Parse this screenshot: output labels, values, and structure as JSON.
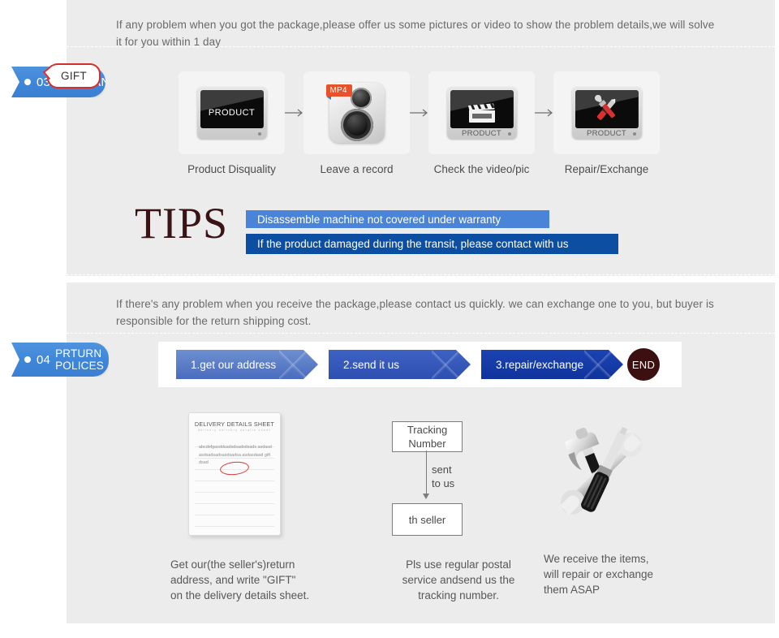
{
  "sections": {
    "warranty": {
      "tab": {
        "dot": true,
        "number": "03",
        "label": "WARRANTY"
      },
      "intro": "If any problem when you got the package,please offer us some pictures or video to show the problem details,we will solve\n it for you within 1 day",
      "steps": [
        {
          "caption": "Product Disquality",
          "icon": "monitor-icon",
          "screen_label": "PRODUCT"
        },
        {
          "caption": "Leave a record",
          "icon": "camera-icon",
          "badge": "MP4"
        },
        {
          "caption": "Check the video/pic",
          "icon": "video-clapper-icon",
          "screen_label": "PRODUCT"
        },
        {
          "caption": "Repair/Exchange",
          "icon": "repair-tools-icon",
          "screen_label": "PRODUCT"
        }
      ],
      "step_arrow": "arrow-right-icon",
      "tips": {
        "word": "TIPS",
        "bars": [
          {
            "text": "Disassemble machine not covered under warranty",
            "color": "#4a84d8"
          },
          {
            "text": "If the product damaged during the transit, please contact with us",
            "color": "#0b4ea2"
          }
        ]
      }
    },
    "return": {
      "tab": {
        "dot": true,
        "number": "04",
        "label": "PRTURN\nPOLICES"
      },
      "intro": "If  there's any problem when you receive the package,please contact us quickly. we can exchange one to you, but buyer is\nresponsible for the return shipping cost.",
      "flow": {
        "steps": [
          {
            "text": "1.get our address",
            "color": "#4a6cbe"
          },
          {
            "text": "2.send it us",
            "color": "#2d4fb0"
          },
          {
            "text": "3.repair/exchange",
            "color": "#10339c"
          }
        ],
        "end": {
          "text": "END",
          "color": "#3c0f10"
        }
      },
      "columns": [
        {
          "graphic": "delivery-details-sheet",
          "sheet": {
            "title": "DELIVERY DETAILS SHEET",
            "subtitle": "delivery        delivery details sheet",
            "body": "abcdefgasddsadsdsadsdsads asdasdasdsadsadsasdsadsa asdasdasd gift dsad",
            "callout": "GIFT"
          },
          "caption": "Get our(the seller's)return\naddress, and write \"GIFT\"\non the delivery details sheet."
        },
        {
          "graphic": "tracking-flow",
          "box_top": "Tracking\nNumber",
          "arrow_label": "sent\nto us",
          "box_bottom": "th seller",
          "caption": "Pls use regular postal\nservice andsend us the\n tracking number."
        },
        {
          "graphic": "hammer-wrench-screwdriver-icon",
          "caption": "We receive the items,\nwill repair or exchange\n them ASAP"
        }
      ]
    }
  }
}
